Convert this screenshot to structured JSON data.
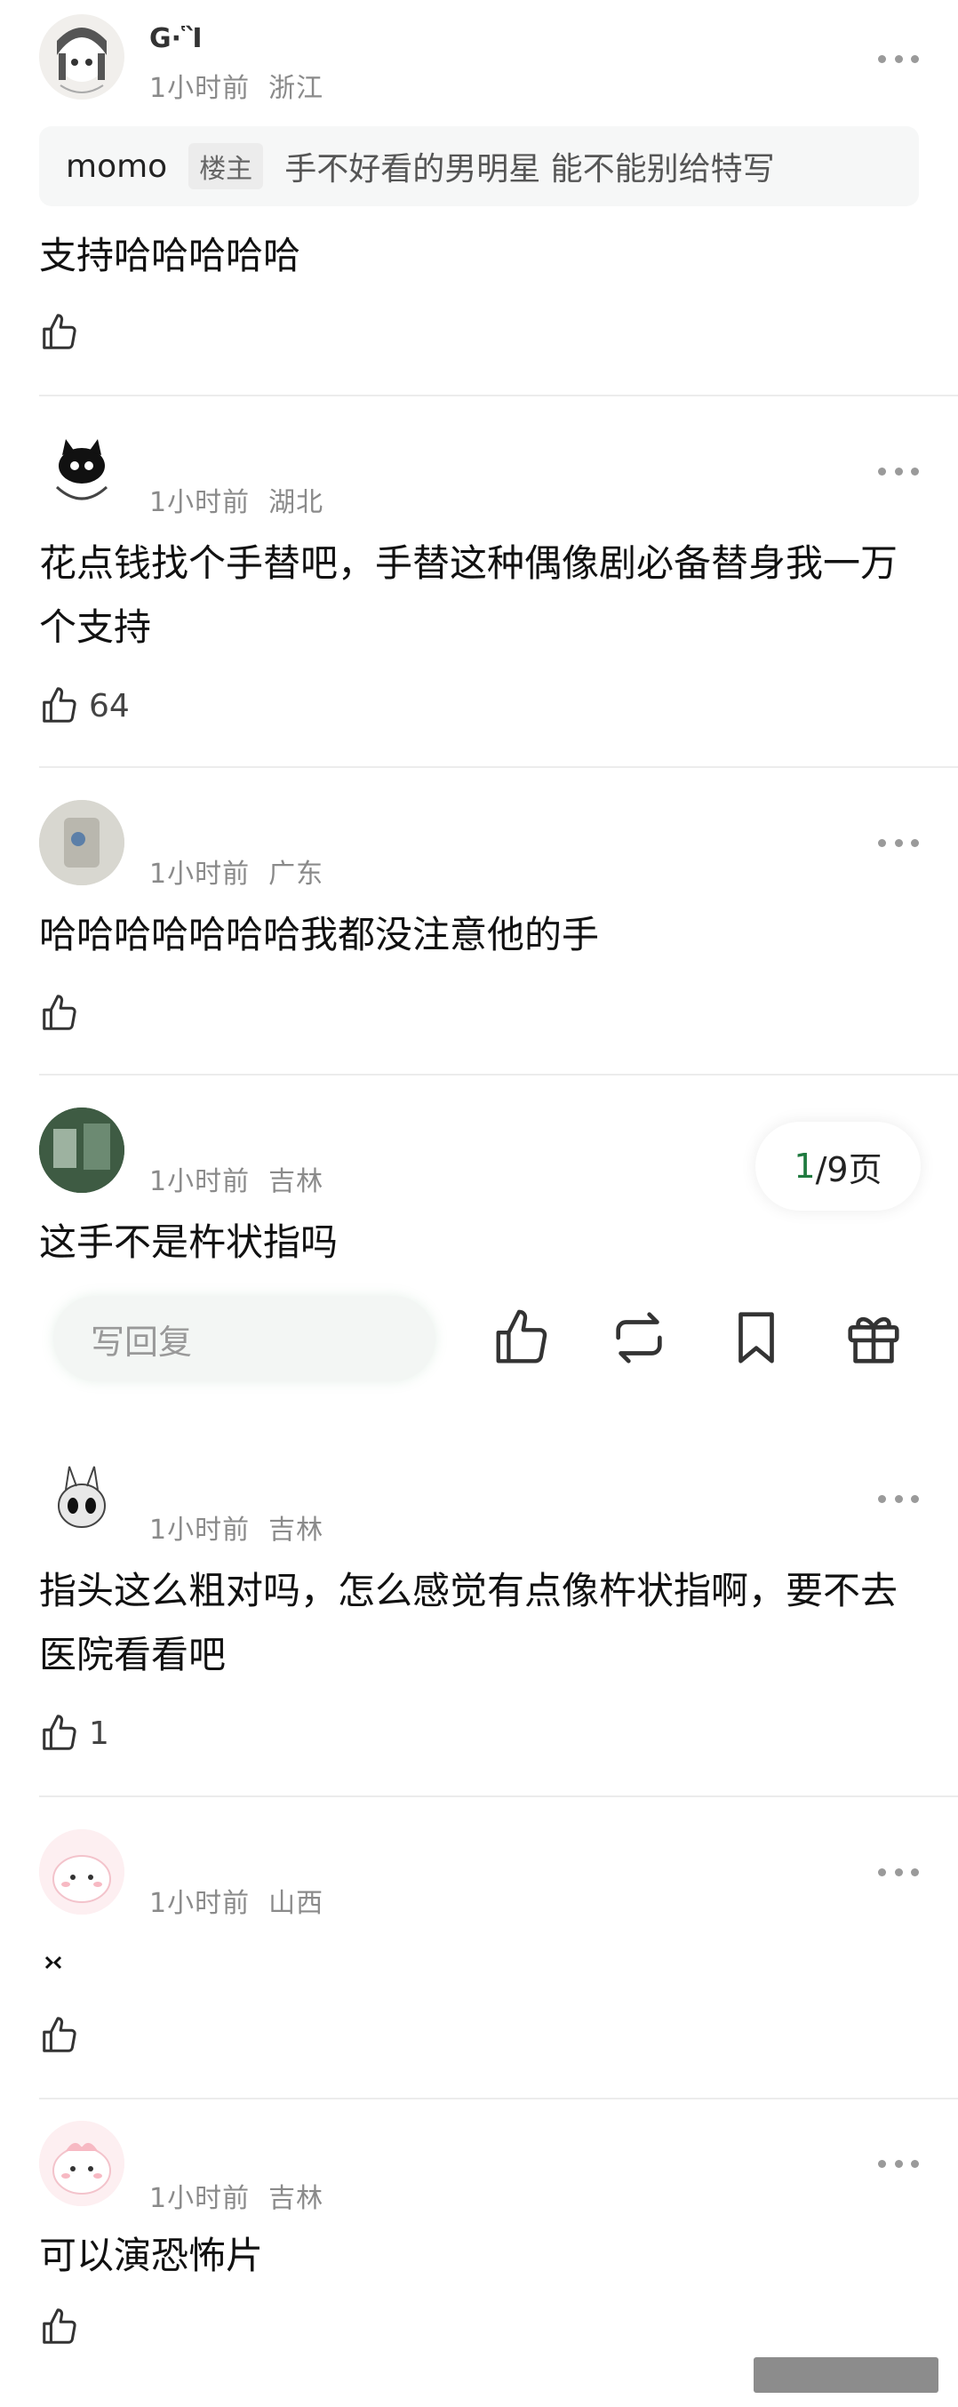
{
  "comments": [
    {
      "username": "G∙Ἳ",
      "time": "1小时前",
      "location": "浙江",
      "text": "支持哈哈哈哈哈",
      "likes": "",
      "quote": {
        "user": "momo",
        "tag": "楼主",
        "text": "手不好看的男明星 能不能别给特写"
      }
    },
    {
      "username": "",
      "time": "1小时前",
      "location": "湖北",
      "text": "花点钱找个手替吧，手替这种偶像剧必备替身我一万个支持",
      "likes": "64"
    },
    {
      "username": "",
      "time": "1小时前",
      "location": "广东",
      "text": "哈哈哈哈哈哈哈我都没注意他的手",
      "likes": ""
    },
    {
      "username": "",
      "time": "1小时前",
      "location": "吉林",
      "text": "这手不是杵状指吗",
      "likes": ""
    },
    {
      "username": "",
      "time": "1小时前",
      "location": "吉林",
      "text": "指头这么粗对吗，怎么感觉有点像杵状指啊，要不去医院看看吧",
      "likes": "1"
    },
    {
      "username": "",
      "time": "1小时前",
      "location": "山西",
      "text": "",
      "likes": ""
    },
    {
      "username": "",
      "time": "1小时前",
      "location": "吉林",
      "text": "可以演恐怖片",
      "likes": ""
    }
  ],
  "pager": {
    "current": "1",
    "rest": "/9页"
  },
  "reply": {
    "placeholder": "写回复"
  },
  "colors": {
    "accent": "#1f7a3f",
    "meta": "#8a8a8a",
    "divider": "#ececec"
  }
}
